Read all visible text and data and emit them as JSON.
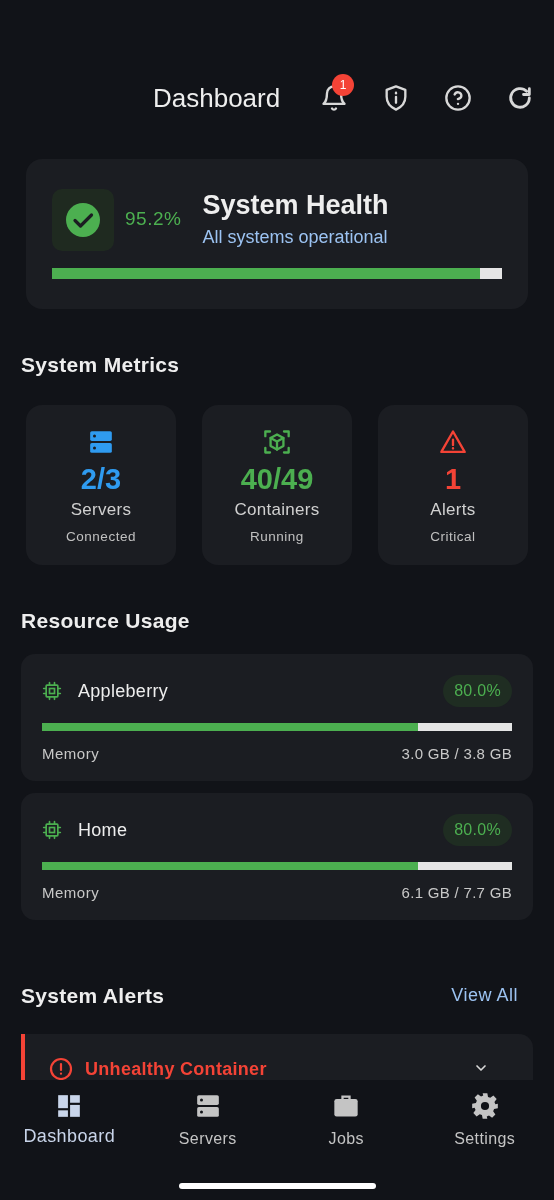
{
  "header": {
    "title": "Dashboard",
    "notification_count": "1"
  },
  "health": {
    "percent": "95.2%",
    "title": "System Health",
    "status": "All systems operational",
    "level": 0.952
  },
  "metrics_title": "System Metrics",
  "metrics": [
    {
      "kind": "servers",
      "color": "#2f9bf0",
      "value": "2/3",
      "label": "Servers",
      "sublabel": "Connected"
    },
    {
      "kind": "containers",
      "color": "#4caf50",
      "value": "40/49",
      "label": "Containers",
      "sublabel": "Running"
    },
    {
      "kind": "alerts",
      "color": "#f44336",
      "value": "1",
      "label": "Alerts",
      "sublabel": "Critical"
    }
  ],
  "resources_title": "Resource Usage",
  "resources": [
    {
      "name": "Appleberry",
      "percent": "80.0%",
      "level": 0.8,
      "metric": "Memory",
      "usage": "3.0 GB / 3.8 GB"
    },
    {
      "name": "Home",
      "percent": "80.0%",
      "level": 0.8,
      "metric": "Memory",
      "usage": "6.1 GB / 7.7 GB"
    }
  ],
  "alerts_section": {
    "title": "System Alerts",
    "link": "View All"
  },
  "alerts": [
    {
      "title": "Unhealthy Container",
      "expanded": false
    }
  ],
  "nav": [
    {
      "kind": "dashboard",
      "label": "Dashboard",
      "selected": true
    },
    {
      "kind": "servers",
      "label": "Servers",
      "selected": false
    },
    {
      "kind": "jobs",
      "label": "Jobs",
      "selected": false
    },
    {
      "kind": "settings",
      "label": "Settings",
      "selected": false
    }
  ]
}
